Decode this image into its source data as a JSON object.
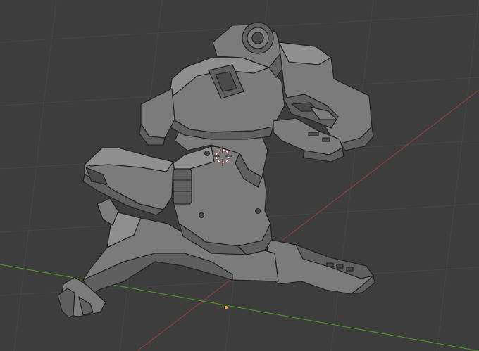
{
  "viewport": {
    "background": "#3d3d3d",
    "grid_color": "#454545",
    "x_axis_color": "#8a3c3c",
    "y_axis_color": "#4c8a2c",
    "origin_color": "#ffaa33",
    "mesh_color": "#7b7b7b"
  },
  "objects": {
    "model": "robotic-dinosaur-mesh",
    "cursor": "3d-cursor-icon",
    "origin": "object-origin-icon"
  }
}
